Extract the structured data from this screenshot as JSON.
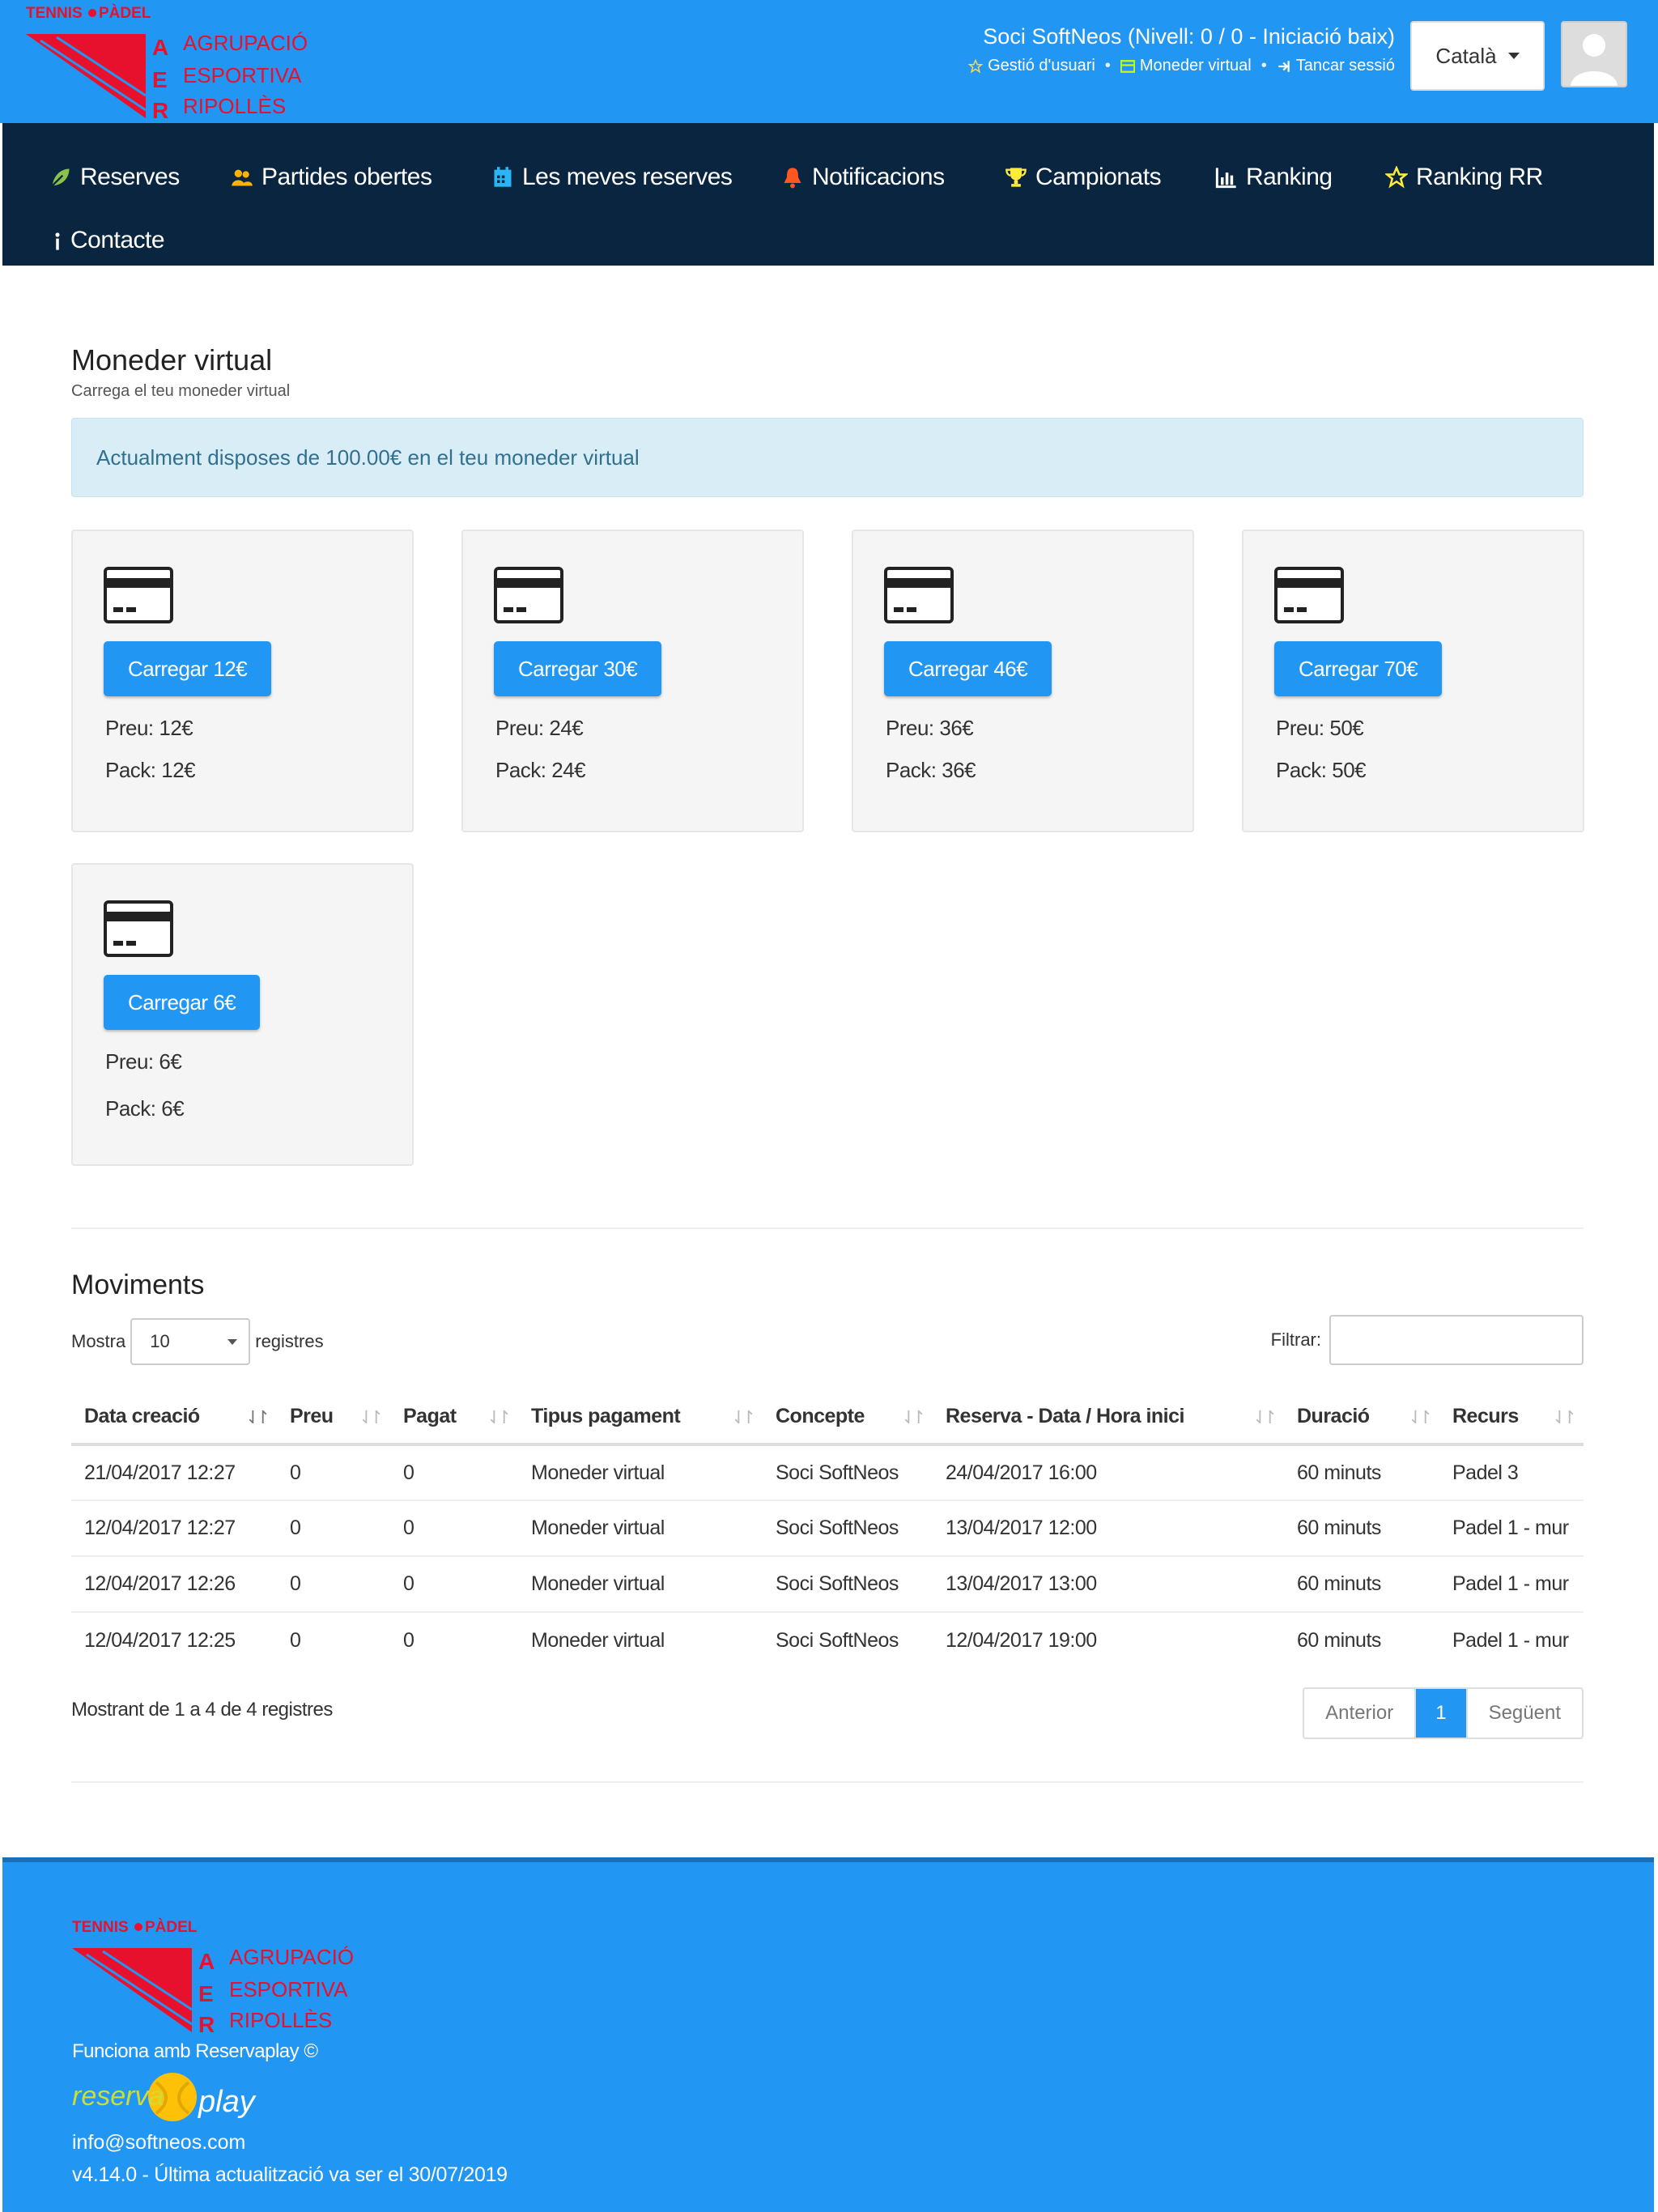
{
  "brand": {
    "small": "TENNIS",
    "small2": "PÀDEL",
    "letters": [
      "A",
      "E",
      "R"
    ],
    "lines": [
      "AGRUPACIÓ",
      "ESPORTIVA",
      "RIPOLLÈS"
    ]
  },
  "header": {
    "user_line": "Soci SoftNeos (Nivell: 0 / 0 - Iniciació baix)",
    "links": [
      "Gestió d'usuari",
      "Moneder virtual",
      "Tancar sessió"
    ],
    "language": "Català"
  },
  "nav": {
    "items": [
      "Reserves",
      "Partides obertes",
      "Les meves reserves",
      "Notificacions",
      "Campionats",
      "Ranking",
      "Ranking RR",
      "Contacte"
    ]
  },
  "wallet": {
    "title": "Moneder virtual",
    "subtitle": "Carrega el teu moneder virtual",
    "alert": "Actualment disposes de 100.00€ en el teu moneder virtual",
    "cards": [
      {
        "button": "Carregar 12€",
        "price": "Preu: 12€",
        "pack": "Pack: 12€"
      },
      {
        "button": "Carregar 30€",
        "price": "Preu: 24€",
        "pack": "Pack: 24€"
      },
      {
        "button": "Carregar 46€",
        "price": "Preu: 36€",
        "pack": "Pack: 36€"
      },
      {
        "button": "Carregar 70€",
        "price": "Preu: 50€",
        "pack": "Pack: 50€"
      },
      {
        "button": "Carregar 6€",
        "price": "Preu: 6€",
        "pack": "Pack: 6€"
      }
    ]
  },
  "movements": {
    "title": "Moviments",
    "show_label": "Mostra",
    "show_value": "10",
    "records_label": "registres",
    "filter_label": "Filtrar:",
    "columns": [
      "Data creació",
      "Preu",
      "Pagat",
      "Tipus pagament",
      "Concepte",
      "Reserva - Data / Hora inici",
      "Duració",
      "Recurs"
    ],
    "rows": [
      [
        "21/04/2017 12:27",
        "0",
        "0",
        "Moneder virtual",
        "Soci SoftNeos",
        "24/04/2017 16:00",
        "60 minuts",
        "Padel 3"
      ],
      [
        "12/04/2017 12:27",
        "0",
        "0",
        "Moneder virtual",
        "Soci SoftNeos",
        "13/04/2017 12:00",
        "60 minuts",
        "Padel 1 - mur"
      ],
      [
        "12/04/2017 12:26",
        "0",
        "0",
        "Moneder virtual",
        "Soci SoftNeos",
        "13/04/2017 13:00",
        "60 minuts",
        "Padel 1 - mur"
      ],
      [
        "12/04/2017 12:25",
        "0",
        "0",
        "Moneder virtual",
        "Soci SoftNeos",
        "12/04/2017 19:00",
        "60 minuts",
        "Padel 1 - mur"
      ]
    ],
    "info": "Mostrant de 1 a 4 de 4 registres",
    "pager": {
      "prev": "Anterior",
      "current": "1",
      "next": "Següent"
    }
  },
  "footer": {
    "powered": "Funciona amb Reservaplay ©",
    "rp_left": "reserva",
    "rp_right": "play",
    "email": "info@softneos.com",
    "version": "v4.14.0 - Última actualització va ser el 30/07/2019"
  },
  "colors": {
    "primary": "#2196f3",
    "nav": "#0a2540",
    "brand_red": "#e8112d",
    "alert_bg": "#d9edf7",
    "alert_text": "#31708f"
  }
}
